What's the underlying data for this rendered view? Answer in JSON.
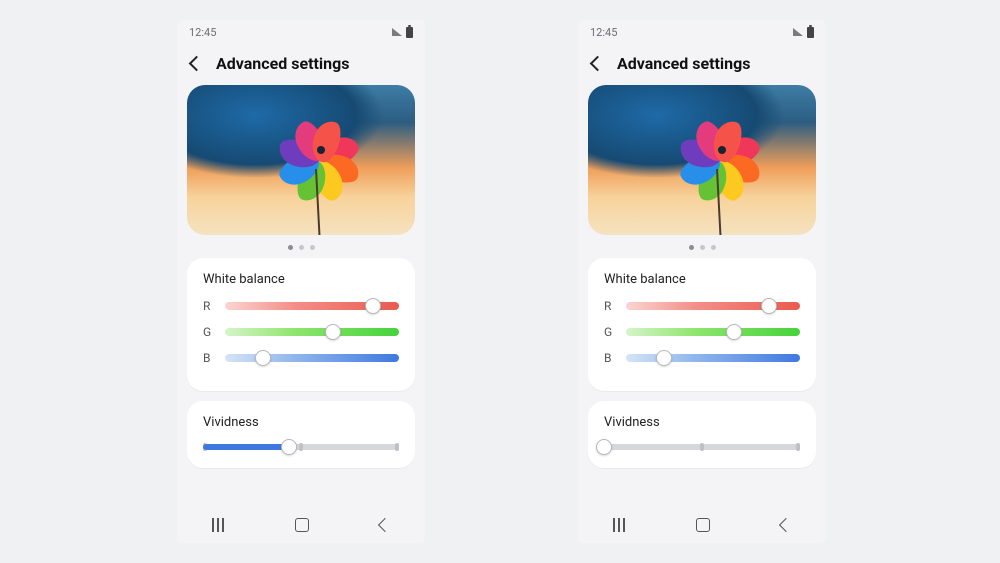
{
  "status": {
    "time": "12:45"
  },
  "header": {
    "title": "Advanced settings"
  },
  "pager": {
    "count": 3,
    "active": 0
  },
  "white_balance": {
    "title": "White balance",
    "labels": {
      "r": "R",
      "g": "G",
      "b": "B"
    }
  },
  "vividness": {
    "title": "Vividness"
  },
  "phones": [
    {
      "id": "left",
      "wb": {
        "r": 85,
        "g": 62,
        "b": 22
      },
      "vividness": 44
    },
    {
      "id": "right",
      "wb": {
        "r": 82,
        "g": 62,
        "b": 22
      },
      "vividness": 0
    }
  ]
}
